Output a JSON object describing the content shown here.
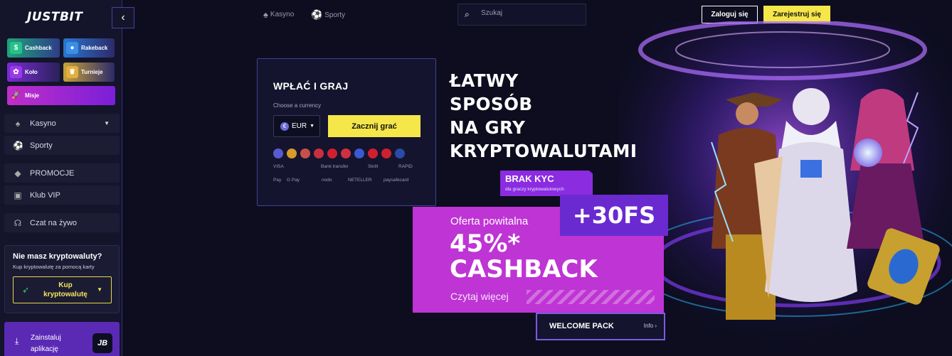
{
  "brand": {
    "logo": "JUSTBIT"
  },
  "sidebar": {
    "collapse": "‹",
    "promos": [
      {
        "label": "Cashback"
      },
      {
        "label": "Rakeback"
      },
      {
        "label": "Koło"
      },
      {
        "label": "Turnieje"
      },
      {
        "label": "Misje"
      }
    ],
    "nav": [
      {
        "label": "Kasyno"
      },
      {
        "label": "Sporty"
      },
      {
        "label": "PROMOCJE"
      },
      {
        "label": "Klub VIP"
      },
      {
        "label": "Czat na żywo"
      }
    ],
    "crypto": {
      "title": "Nie masz kryptowaluty?",
      "subtitle": "Kup kryptowalutę za pomocą karty",
      "buy_label": "Kup kryptowalutę"
    },
    "install": {
      "label": "Zainstaluj aplikację",
      "badge": "JB"
    }
  },
  "header": {
    "links": [
      {
        "label": "Kasyno"
      },
      {
        "label": "Sporty"
      }
    ],
    "search": {
      "placeholder": "Szukaj"
    },
    "login": "Zaloguj się",
    "register": "Zarejestruj się"
  },
  "deposit": {
    "title": "WPŁAĆ I GRAJ",
    "choose": "Choose a currency",
    "currency": "EUR",
    "start": "Zacznij grać",
    "payments": [
      "VISA",
      "Bank transfer",
      "Skrill",
      "RAPID",
      "Pay",
      "G Pay",
      "nodo",
      "NETELLER",
      "paysafecard"
    ],
    "currency_colors": [
      "#5a5ad0",
      "#d89a2a",
      "#c8504a",
      "#c83040",
      "#d02030",
      "#d03040",
      "#3a5ad0",
      "#d02030",
      "#d02030",
      "#2a4aa8"
    ]
  },
  "hero": {
    "headline": [
      "ŁATWY",
      "SPOSÓB",
      "NA GRY",
      "KRYPTOWALUTAMI"
    ],
    "brak_title": "BRAK KYC",
    "brak_sub": "dla graczy kryptowalutowych",
    "fs": "+30FS",
    "offer_pre": "Oferta powitalna",
    "offer_pct": "45%*",
    "offer_cashback": "CASHBACK",
    "offer_more": "Czytaj więcej",
    "welcome": "WELCOME PACK",
    "info": "Info ›"
  }
}
